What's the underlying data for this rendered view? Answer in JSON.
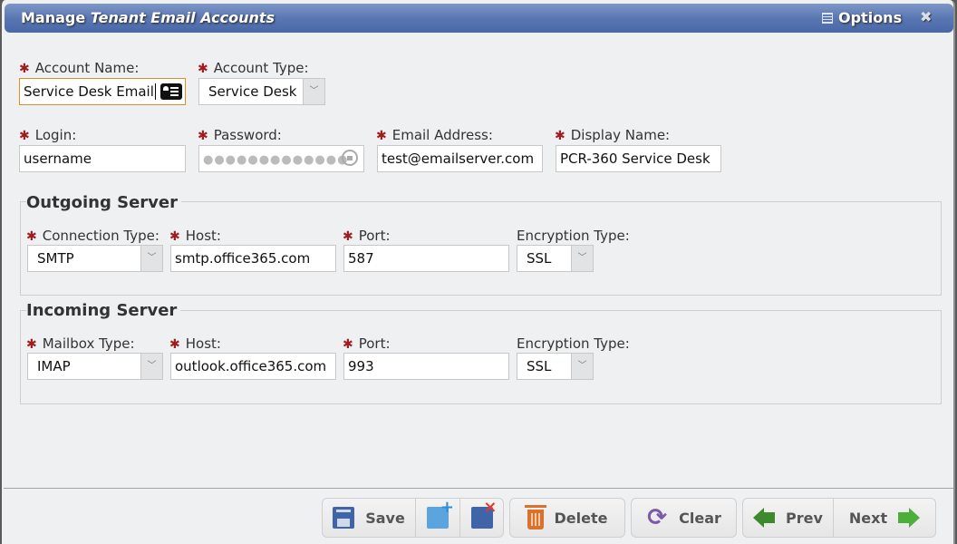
{
  "window": {
    "title_prefix": "Manage",
    "title_main": "Tenant Email Accounts",
    "options_label": "Options",
    "close_label": "✖"
  },
  "account": {
    "account_name_label": "Account Name:",
    "account_name_value": "Service Desk Email",
    "account_type_label": "Account Type:",
    "account_type_value": "Service Desk",
    "login_label": "Login:",
    "login_value": "username",
    "password_label": "Password:",
    "password_mask": "●●●●●●●●●●●●●",
    "email_label": "Email Address:",
    "email_value": "test@emailserver.com",
    "display_name_label": "Display Name:",
    "display_name_value": "PCR-360 Service Desk"
  },
  "outgoing": {
    "legend": "Outgoing Server",
    "connection_type_label": "Connection Type:",
    "connection_type_value": "SMTP",
    "host_label": "Host:",
    "host_value": "smtp.office365.com",
    "port_label": "Port:",
    "port_value": "587",
    "encryption_label": "Encryption Type:",
    "encryption_value": "SSL"
  },
  "incoming": {
    "legend": "Incoming Server",
    "mailbox_type_label": "Mailbox Type:",
    "mailbox_type_value": "IMAP",
    "host_label": "Host:",
    "host_value": "outlook.office365.com",
    "port_label": "Port:",
    "port_value": "993",
    "encryption_label": "Encryption Type:",
    "encryption_value": "SSL"
  },
  "required_marker": "✱",
  "combo_arrow": "﹀",
  "toolbar": {
    "save": "Save",
    "delete": "Delete",
    "clear": "Clear",
    "prev": "Prev",
    "next": "Next",
    "refresh_glyph": "⟳"
  }
}
